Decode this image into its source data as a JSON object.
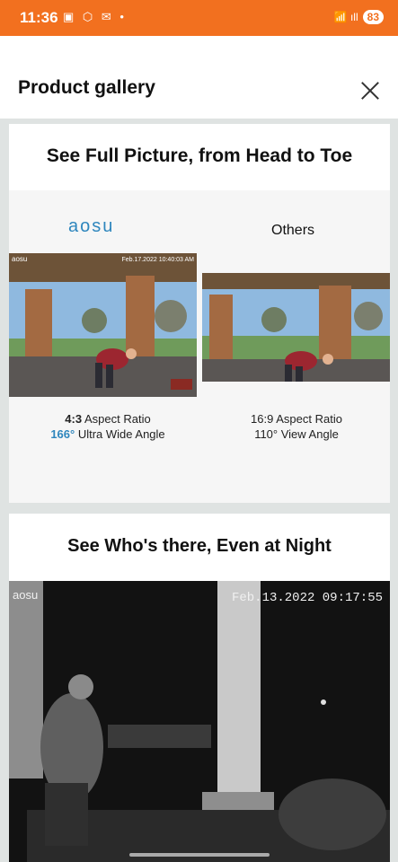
{
  "status_bar": {
    "time": "11:36",
    "left_icons": "▣ ⬡ ✉ •",
    "right_icons": "📶 ıll",
    "battery": "83"
  },
  "header": {
    "title": "Product gallery",
    "close_icon": "close-icon"
  },
  "card1": {
    "title": "See Full Picture, from Head to Toe",
    "brand": "aosu",
    "others": "Others",
    "photo_a_overlay_left": "aosu",
    "photo_a_overlay_right": "Feb.17.2022 10:40:03 AM",
    "spec_a": {
      "ratio_value": "4:3",
      "ratio_label": " Aspect Ratio",
      "angle_value": "166°",
      "angle_label": " Ultra Wide Angle"
    },
    "spec_b": {
      "ratio": "16:9 Aspect Ratio",
      "angle": "110° View Angle"
    }
  },
  "card2": {
    "title": "See Who's there, Even at Night",
    "overlay_left": "aosu",
    "overlay_right": "Feb.13.2022 09:17:55"
  },
  "colors": {
    "status_bar": "#f2701f",
    "brand_blue": "#2e86bd"
  }
}
